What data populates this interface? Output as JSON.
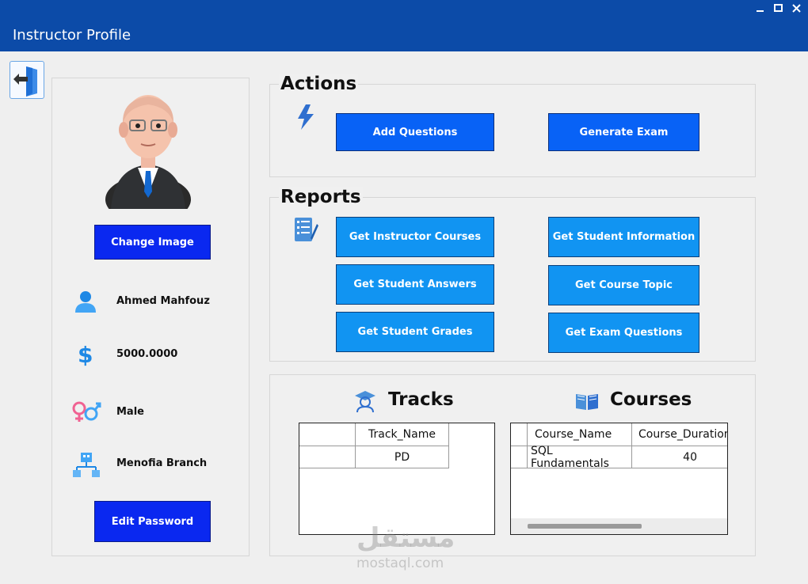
{
  "window": {
    "title": "Instructor Profile",
    "minimize": "▬",
    "maximize": "□",
    "close": "✕"
  },
  "profile": {
    "change_image_label": "Change Image",
    "name": "Ahmed Mahfouz",
    "salary": "5000.0000",
    "gender": "Male",
    "branch": "Menofia Branch",
    "edit_password_label": "Edit Password"
  },
  "actions": {
    "title": "Actions",
    "add_questions": "Add Questions",
    "generate_exam": "Generate Exam"
  },
  "reports": {
    "title": "Reports",
    "get_instructor_courses": "Get Instructor Courses",
    "get_student_information": "Get Student Information",
    "get_student_answers": "Get Student Answers",
    "get_course_topic": "Get Course Topic",
    "get_student_grades": "Get Student Grades",
    "get_exam_questions": "Get Exam Questions"
  },
  "tracks": {
    "title": "Tracks",
    "columns": [
      "Track_Name"
    ],
    "rows": [
      [
        "PD"
      ]
    ]
  },
  "courses": {
    "title": "Courses",
    "columns": [
      "Course_Name",
      "Course_Duration"
    ],
    "rows": [
      [
        "SQL Fundamentals",
        "40"
      ]
    ]
  },
  "watermark": {
    "arabic": "مستقل",
    "latin": "mostaql.com"
  }
}
